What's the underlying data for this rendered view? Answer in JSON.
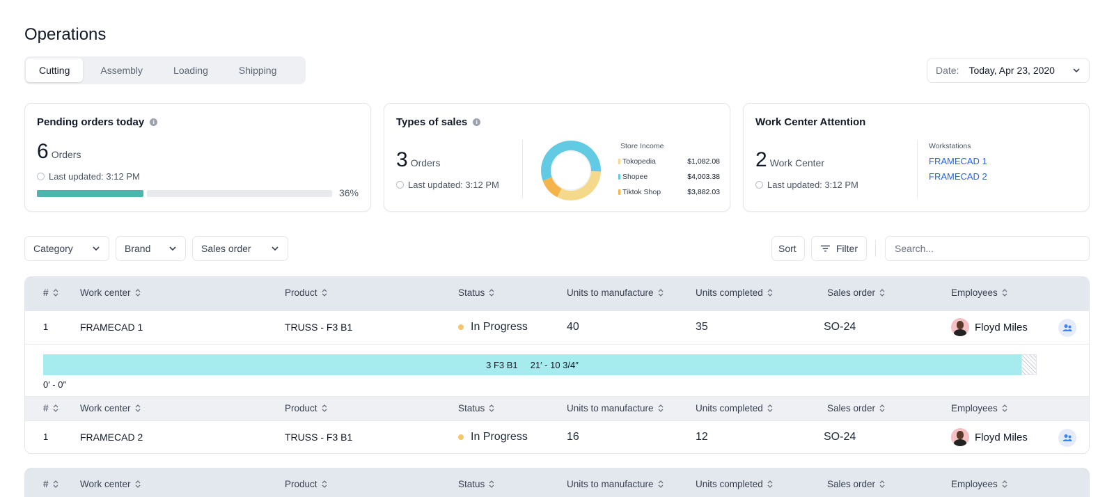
{
  "page": {
    "title": "Operations"
  },
  "tabs": [
    {
      "label": "Cutting",
      "active": true
    },
    {
      "label": "Assembly",
      "active": false
    },
    {
      "label": "Loading",
      "active": false
    },
    {
      "label": "Shipping",
      "active": false
    }
  ],
  "date": {
    "label": "Date:",
    "value": "Today, Apr 23, 2020"
  },
  "cards": {
    "pending": {
      "title": "Pending orders today",
      "count": "6",
      "unit": "Orders",
      "updated": "Last updated: 3:12 PM",
      "progress_pct": 36,
      "progress_label": "36%"
    },
    "sales": {
      "title": "Types of sales",
      "count": "3",
      "unit": "Orders",
      "updated": "Last updated: 3:12 PM",
      "legend_title": "Store Income",
      "stores": [
        {
          "name": "Tokopedia",
          "amount": "$1,082.08",
          "color": "#f5d98a"
        },
        {
          "name": "Shopee",
          "amount": "$4,003.38",
          "color": "#62cbe3"
        },
        {
          "name": "Tiktok Shop",
          "amount": "$3,882.03",
          "color": "#f5b44a"
        }
      ],
      "donut_segments": [
        {
          "store": "Shopee",
          "fraction": 0.56,
          "color": "#62cbe3"
        },
        {
          "store": "Tokopedia",
          "fraction": 0.32,
          "color": "#f5d98a"
        },
        {
          "store": "Tiktok Shop",
          "fraction": 0.12,
          "color": "#f5b44a"
        }
      ]
    },
    "attention": {
      "title": "Work Center Attention",
      "count": "2",
      "unit": "Work Center",
      "updated": "Last updated: 3:12 PM",
      "ws_title": "Workstations",
      "workstations": [
        "FRAMECAD 1",
        "FRAMECAD 2"
      ]
    }
  },
  "filters": {
    "category": "Category",
    "brand": "Brand",
    "sales_order": "Sales order",
    "sort": "Sort",
    "filter": "Filter",
    "search_placeholder": "Search..."
  },
  "table": {
    "columns": [
      "#",
      "Work center",
      "Product",
      "Status",
      "Units to manufacture",
      "Units completed",
      "Sales order",
      "Employees"
    ],
    "rows": [
      {
        "num": "1",
        "work_center": "FRAMECAD 1",
        "product": "TRUSS - F3 B1",
        "status": "In Progress",
        "units_to_manufacture": "40",
        "units_completed": "35",
        "sales_order": "SO-24",
        "employee": "Floyd Miles"
      },
      {
        "num": "1",
        "work_center": "FRAMECAD 2",
        "product": "TRUSS - F3 B1",
        "status": "In Progress",
        "units_to_manufacture": "16",
        "units_completed": "12",
        "sales_order": "SO-24",
        "employee": "Floyd Miles"
      }
    ],
    "cut": {
      "piece": "3 F3 B1",
      "length": "21′ - 10 3/4″",
      "start": "0′ - 0″"
    }
  },
  "colors": {
    "accent_teal": "#4db5ad",
    "link_blue": "#2563eb",
    "status_progress": "#f5c66a",
    "cut_bar": "#a6ebee"
  }
}
